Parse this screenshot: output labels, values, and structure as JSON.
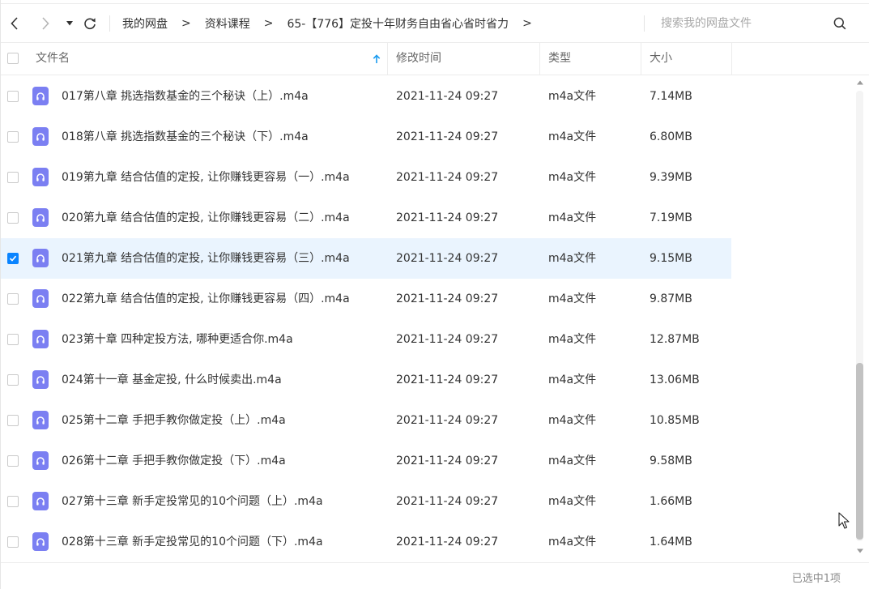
{
  "nav": {
    "back_icon": "chevron-left-icon",
    "forward_icon": "chevron-right-icon",
    "history_icon": "caret-down-icon",
    "refresh_icon": "refresh-icon",
    "breadcrumbs": [
      {
        "label": "我的网盘"
      },
      {
        "label": "资料课程"
      },
      {
        "label": "65-【776】定投十年财务自由省心省时省力"
      }
    ],
    "breadcrumb_separator": ">",
    "trailing_separator": ">",
    "search": {
      "placeholder": "搜索我的网盘文件",
      "value": "",
      "icon": "search-icon"
    }
  },
  "table": {
    "columns": {
      "name": "文件名",
      "modified": "修改时间",
      "type": "类型",
      "size": "大小"
    },
    "sort": {
      "column": "name",
      "direction": "asc",
      "icon": "arrow-up-icon",
      "color": "#1a9bf0"
    },
    "rows": [
      {
        "name": "017第八章 挑选指数基金的三个秘诀（上）.m4a",
        "modified": "2021-11-24 09:27",
        "type": "m4a文件",
        "size": "7.14MB",
        "selected": false
      },
      {
        "name": "018第八章 挑选指数基金的三个秘诀（下）.m4a",
        "modified": "2021-11-24 09:27",
        "type": "m4a文件",
        "size": "6.80MB",
        "selected": false
      },
      {
        "name": "019第九章 结合估值的定投, 让你赚钱更容易（一）.m4a",
        "modified": "2021-11-24 09:27",
        "type": "m4a文件",
        "size": "9.39MB",
        "selected": false
      },
      {
        "name": "020第九章 结合估值的定投, 让你赚钱更容易（二）.m4a",
        "modified": "2021-11-24 09:27",
        "type": "m4a文件",
        "size": "7.19MB",
        "selected": false
      },
      {
        "name": "021第九章 结合估值的定投, 让你赚钱更容易（三）.m4a",
        "modified": "2021-11-24 09:27",
        "type": "m4a文件",
        "size": "9.15MB",
        "selected": true
      },
      {
        "name": "022第九章 结合估值的定投, 让你赚钱更容易（四）.m4a",
        "modified": "2021-11-24 09:27",
        "type": "m4a文件",
        "size": "9.87MB",
        "selected": false
      },
      {
        "name": "023第十章 四种定投方法, 哪种更适合你.m4a",
        "modified": "2021-11-24 09:27",
        "type": "m4a文件",
        "size": "12.87MB",
        "selected": false
      },
      {
        "name": "024第十一章 基金定投, 什么时候卖出.m4a",
        "modified": "2021-11-24 09:27",
        "type": "m4a文件",
        "size": "13.06MB",
        "selected": false
      },
      {
        "name": "025第十二章 手把手教你做定投（上）.m4a",
        "modified": "2021-11-24 09:27",
        "type": "m4a文件",
        "size": "10.85MB",
        "selected": false
      },
      {
        "name": "026第十二章 手把手教你做定投（下）.m4a",
        "modified": "2021-11-24 09:27",
        "type": "m4a文件",
        "size": "9.58MB",
        "selected": false
      },
      {
        "name": "027第十三章 新手定投常见的10个问题（上）.m4a",
        "modified": "2021-11-24 09:27",
        "type": "m4a文件",
        "size": "1.66MB",
        "selected": false
      },
      {
        "name": "028第十三章 新手定投常见的10个问题（下）.m4a",
        "modified": "2021-11-24 09:27",
        "type": "m4a文件",
        "size": "1.64MB",
        "selected": false
      }
    ],
    "file_icon": "audio-file-icon",
    "file_icon_color": "#7b7ff2",
    "selected_row_color": "#eaf4fe",
    "checkbox_checked_color": "#0a84ff"
  },
  "footer": {
    "status": "已选中1项"
  }
}
